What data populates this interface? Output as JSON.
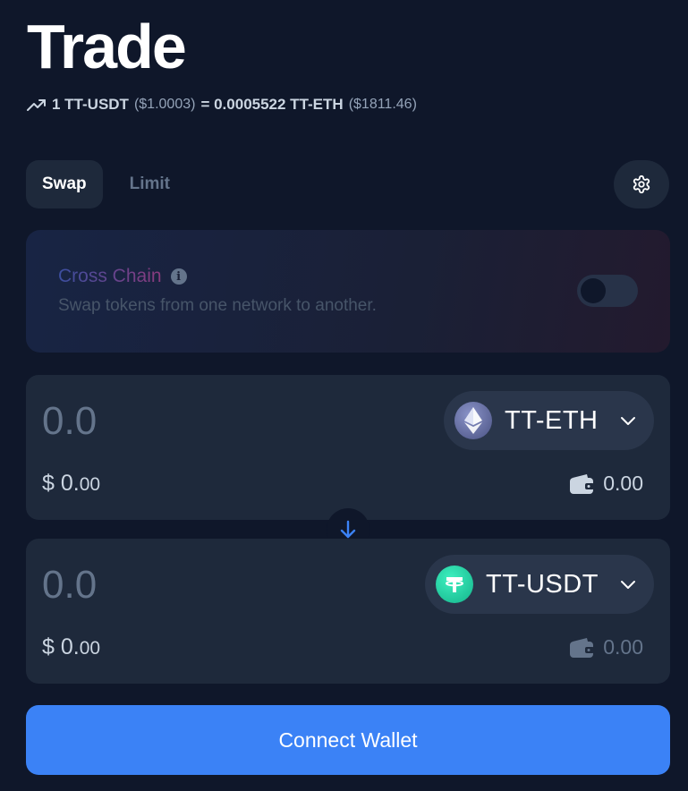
{
  "header": {
    "title": "Trade",
    "rate": {
      "base": "1 TT-USDT",
      "base_usd": "($1.0003)",
      "quote": "= 0.0005522 TT-ETH",
      "quote_usd": "($1811.46)"
    }
  },
  "tabs": [
    {
      "label": "Swap",
      "active": true
    },
    {
      "label": "Limit",
      "active": false
    }
  ],
  "settings_icon": "gear-icon",
  "cross_chain": {
    "title": "Cross Chain",
    "description": "Swap tokens from one network to another.",
    "enabled": false
  },
  "from": {
    "placeholder": "0.0",
    "token": "TT-ETH",
    "usd_dollars": "$ 0.",
    "usd_cents": "00",
    "balance": "0.00"
  },
  "to": {
    "placeholder": "0.0",
    "token": "TT-USDT",
    "usd_dollars": "$ 0.",
    "usd_cents": "00",
    "balance": "0.00"
  },
  "connect_label": "Connect Wallet",
  "colors": {
    "background": "#0f172a",
    "panel": "#1e293b",
    "accent": "#3b82f6"
  }
}
